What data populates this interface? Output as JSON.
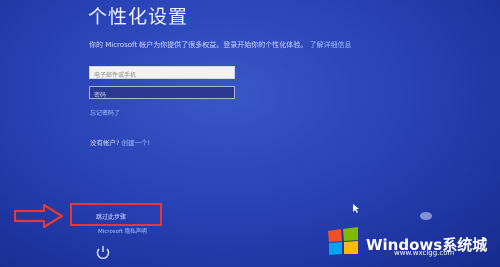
{
  "header": {
    "title": "个性化设置"
  },
  "intro": {
    "text": "你的 Microsoft 帐户为你提供了很多权益。登录开始你的个性化体验。",
    "link": "了解详细信息"
  },
  "form": {
    "email_placeholder": "电子邮件或手机",
    "password_placeholder": "密码",
    "forgot_link": "忘记密码了"
  },
  "signup": {
    "prompt": "没有帐户?",
    "link": "创建一个!"
  },
  "footer": {
    "skip_label": "跳过此步骤",
    "privacy_label": "Microsoft 隐私声明"
  },
  "watermark": {
    "brand": "Windows",
    "brand_cn": "系统城",
    "url": "www.wxclgg.com"
  },
  "colors": {
    "background": "#2a43b6",
    "highlight": "#e53935",
    "link": "#9fc2ff"
  },
  "icons": {
    "ease_of_access": "ease-of-access-icon",
    "annotation_arrow": "arrow-right-icon",
    "logo": "windows-logo-icon"
  }
}
